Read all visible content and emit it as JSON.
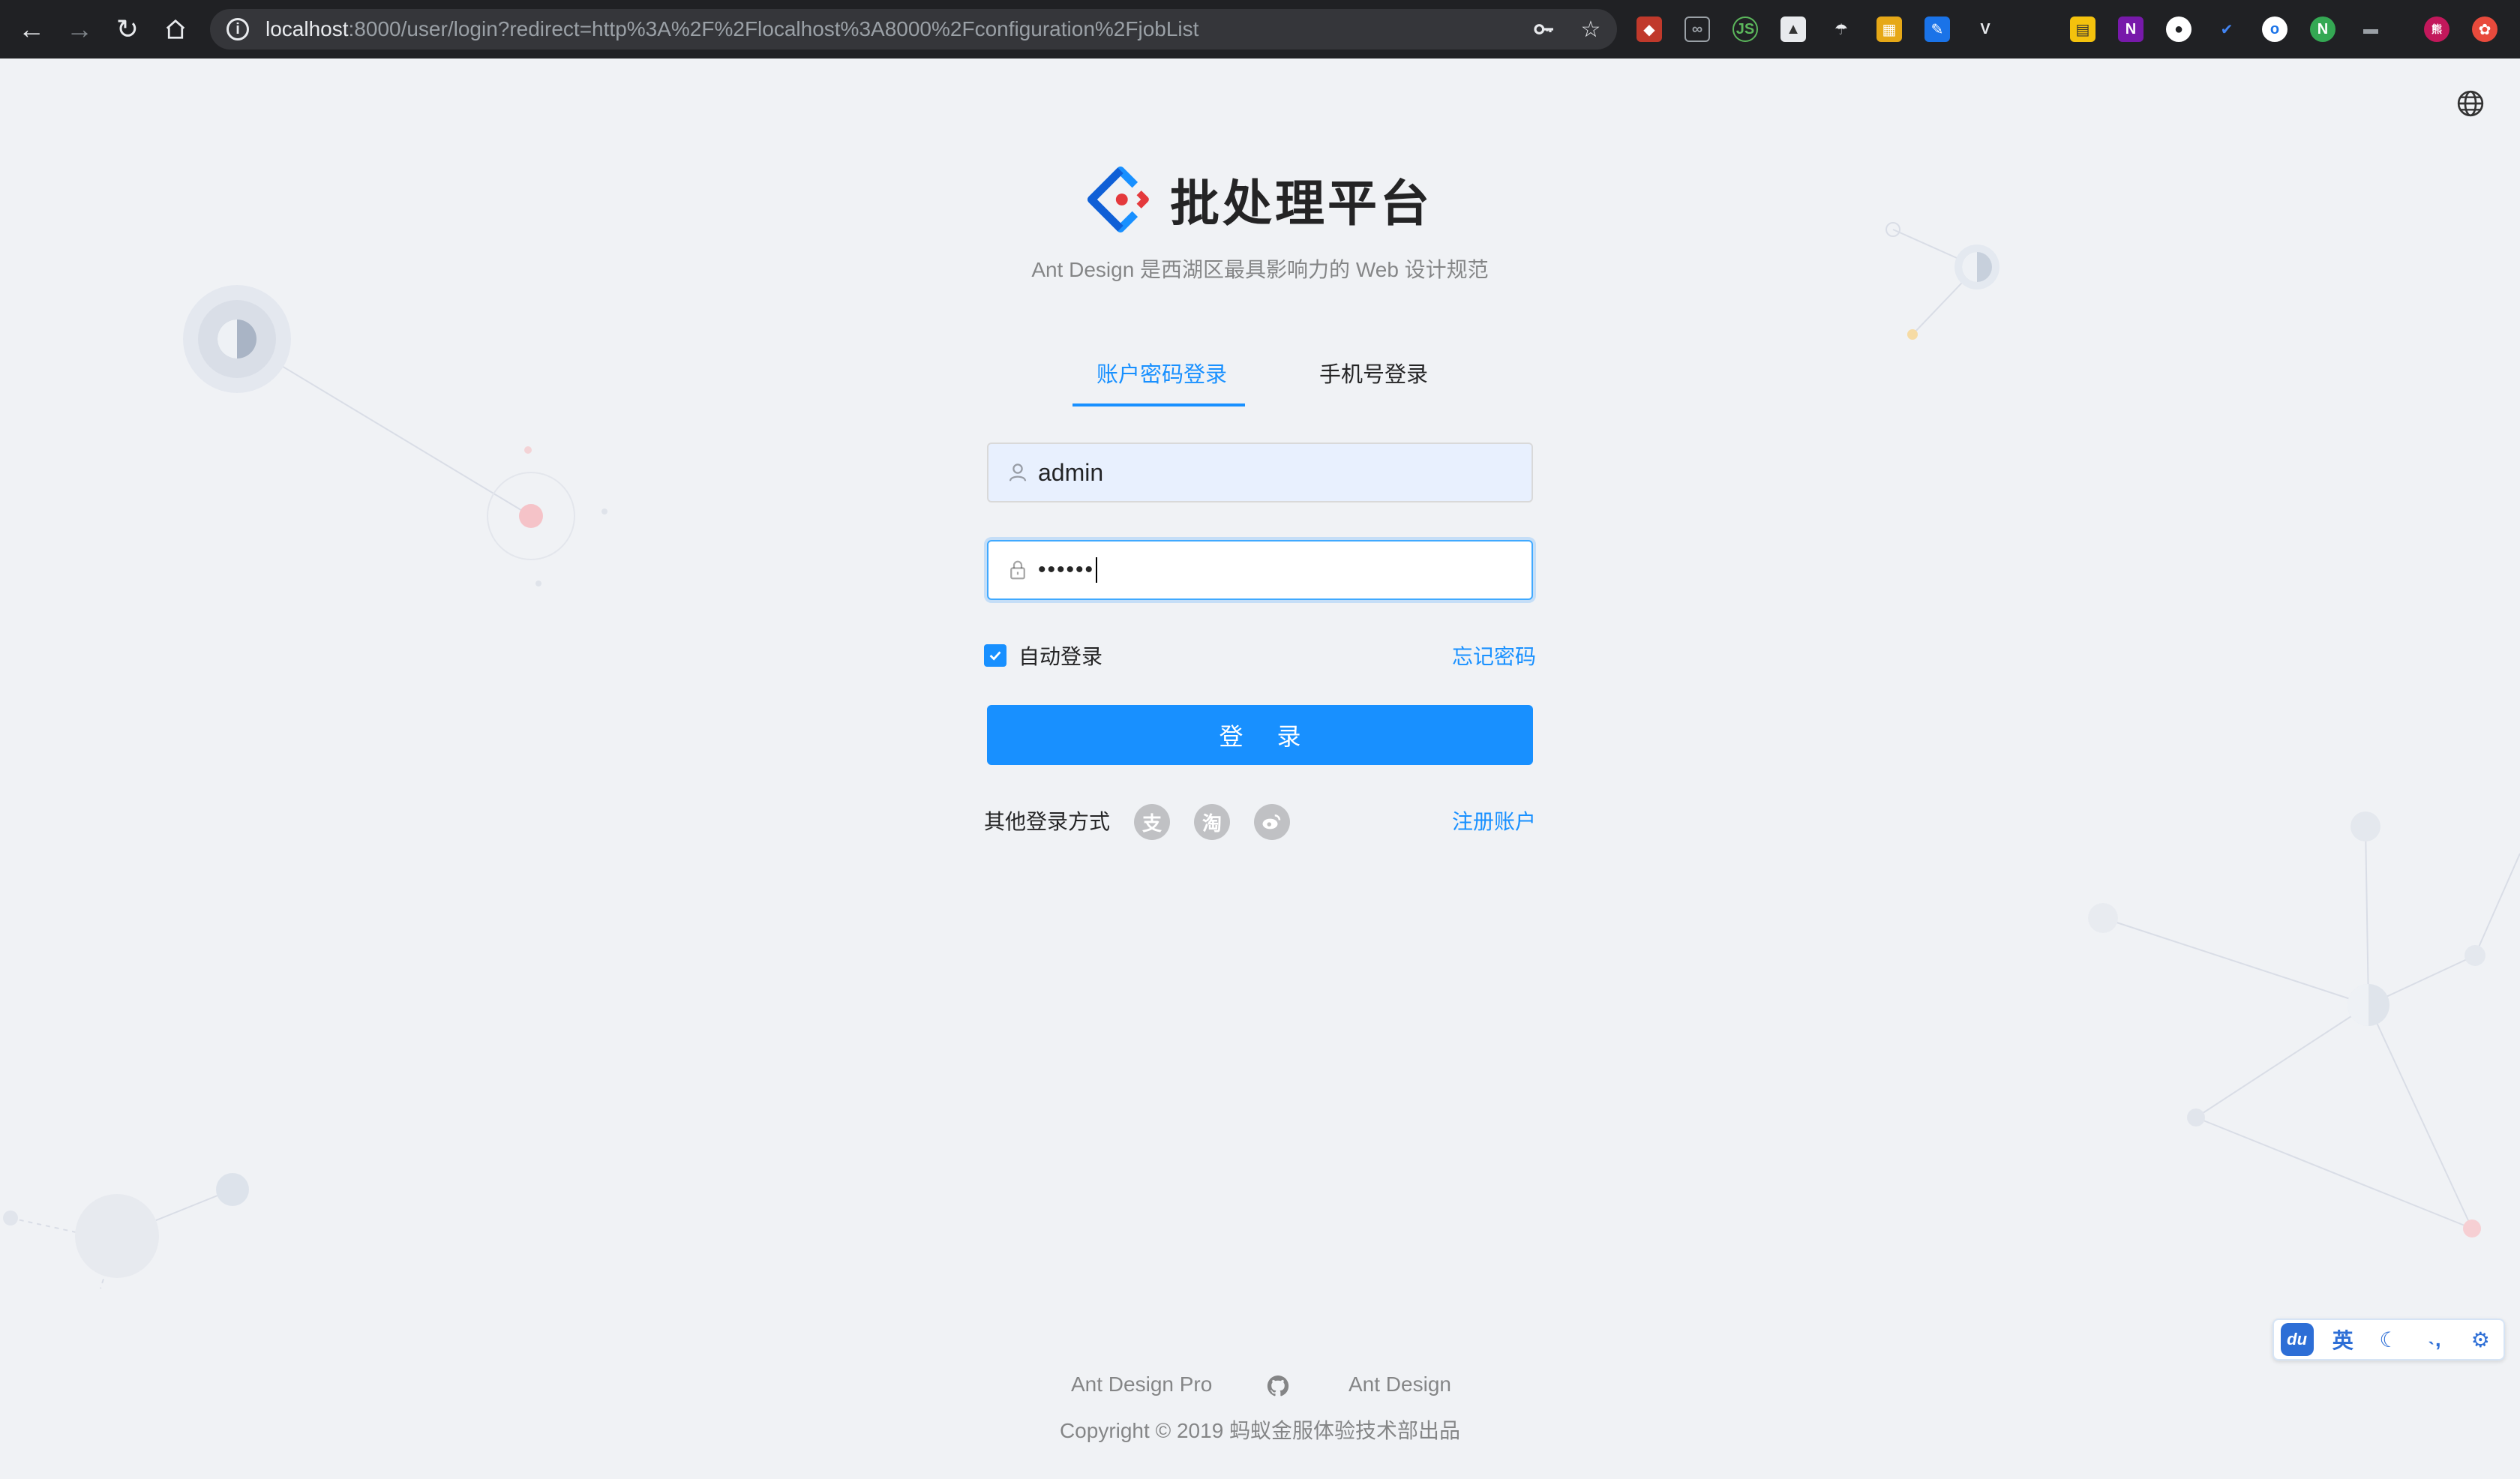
{
  "browser": {
    "url_host": "localhost",
    "url_rest": ":8000/user/login?redirect=http%3A%2F%2Flocalhost%3A8000%2Fconfiguration%2FjobList"
  },
  "header": {
    "title": "批处理平台",
    "subtitle": "Ant Design 是西湖区最具影响力的 Web 设计规范"
  },
  "tabs": [
    {
      "label": "账户密码登录",
      "active": true
    },
    {
      "label": "手机号登录",
      "active": false
    }
  ],
  "login": {
    "username": "admin",
    "password_masked": "••••••",
    "auto_login_label": "自动登录",
    "auto_login_checked": true,
    "forgot_label": "忘记密码",
    "submit_label": "登 录",
    "other_login_label": "其他登录方式",
    "register_label": "注册账户"
  },
  "footer": {
    "links": [
      "Ant Design Pro",
      "Ant Design"
    ],
    "copyright": "Copyright © 2019 蚂蚁金服体验技术部出品"
  },
  "ime": {
    "brand": "du",
    "lang": "英"
  },
  "colors": {
    "primary": "#1890ff",
    "background": "#f0f2f5",
    "chrome": "#202124"
  },
  "icons": [
    "back-icon",
    "forward-icon",
    "reload-icon",
    "home-icon",
    "info-icon",
    "key-icon",
    "star-icon",
    "globe-icon",
    "user-icon",
    "lock-icon",
    "check-icon",
    "alipay-icon",
    "taobao-icon",
    "weibo-icon",
    "github-icon",
    "moon-icon",
    "settings-icon"
  ]
}
